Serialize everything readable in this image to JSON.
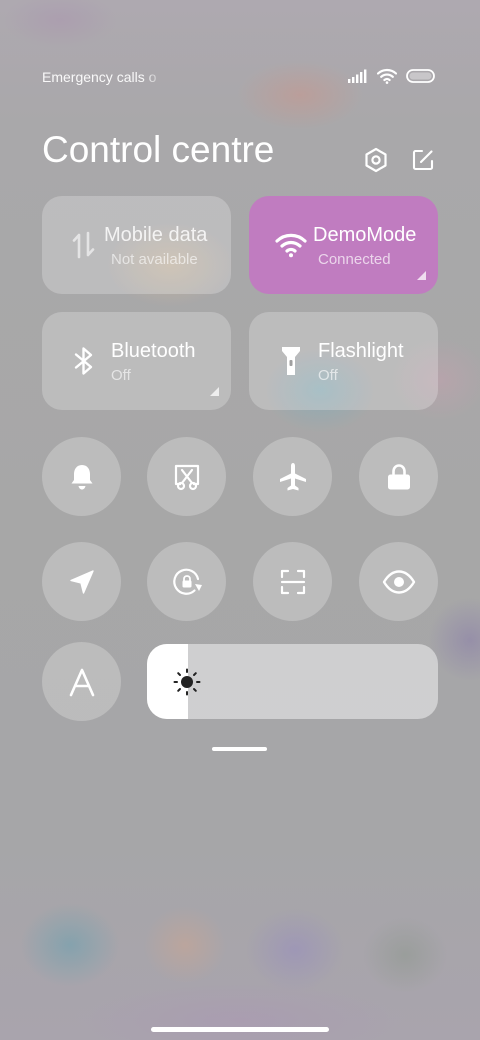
{
  "status_bar": {
    "carrier_text": "Emergency calls o",
    "icons": [
      "signal-icon",
      "wifi-icon",
      "battery-icon"
    ]
  },
  "header": {
    "title": "Control centre",
    "icons": [
      "settings-icon",
      "edit-icon"
    ]
  },
  "tiles": [
    {
      "name": "mobile-data",
      "label": "Mobile data",
      "status": "Not available",
      "icon": "mobile-data-icon",
      "active": false
    },
    {
      "name": "wifi",
      "label": "DemoMode",
      "status": "Connected",
      "icon": "wifi-icon",
      "active": true,
      "color": "#c07cc0"
    },
    {
      "name": "bluetooth",
      "label": "Bluetooth",
      "status": "Off",
      "icon": "bluetooth-icon",
      "active": false
    },
    {
      "name": "flashlight",
      "label": "Flashlight",
      "status": "Off",
      "icon": "flashlight-icon",
      "active": false
    }
  ],
  "toggles_row1": [
    "bell-icon",
    "screenshot-icon",
    "airplane-icon",
    "lock-icon"
  ],
  "toggles_row2": [
    "location-icon",
    "rotation-lock-icon",
    "scan-icon",
    "eye-icon"
  ],
  "auto_brightness": {
    "label": "A",
    "icon": "auto-brightness-icon"
  },
  "brightness": {
    "level": 0.14,
    "icon": "sun-icon"
  },
  "colors": {
    "wifi_active": "#c07cc0",
    "tile_bg": "rgba(255,255,255,0.24)"
  }
}
